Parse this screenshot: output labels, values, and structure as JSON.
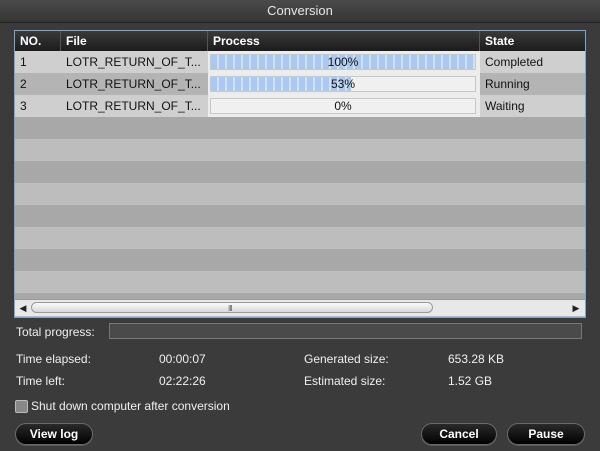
{
  "window": {
    "title": "Conversion"
  },
  "table": {
    "headers": {
      "no": "NO.",
      "file": "File",
      "process": "Process",
      "state": "State"
    },
    "rows": [
      {
        "no": "1",
        "file": "LOTR_RETURN_OF_T...",
        "progress": 1.0,
        "progress_label": "100%",
        "state": "Completed"
      },
      {
        "no": "2",
        "file": "LOTR_RETURN_OF_T...",
        "progress": 0.53,
        "progress_label": "53%",
        "state": "Running"
      },
      {
        "no": "3",
        "file": "LOTR_RETURN_OF_T...",
        "progress": 0.0,
        "progress_label": "0%",
        "state": "Waiting"
      }
    ],
    "scroll_grip": "III"
  },
  "stats": {
    "total_progress_label": "Total progress:",
    "time_elapsed_label": "Time elapsed:",
    "time_elapsed": "00:00:07",
    "time_left_label": "Time left:",
    "time_left": "02:22:26",
    "generated_size_label": "Generated size:",
    "generated_size": "653.28 KB",
    "estimated_size_label": "Estimated size:",
    "estimated_size": "1.52 GB"
  },
  "shutdown": {
    "label": "Shut down computer after conversion",
    "checked": false
  },
  "buttons": {
    "view_log": "View log",
    "cancel": "Cancel",
    "pause": "Pause"
  },
  "colors": {
    "accent": "#7aa6d8",
    "progress_fill": "#a9c9f0"
  }
}
